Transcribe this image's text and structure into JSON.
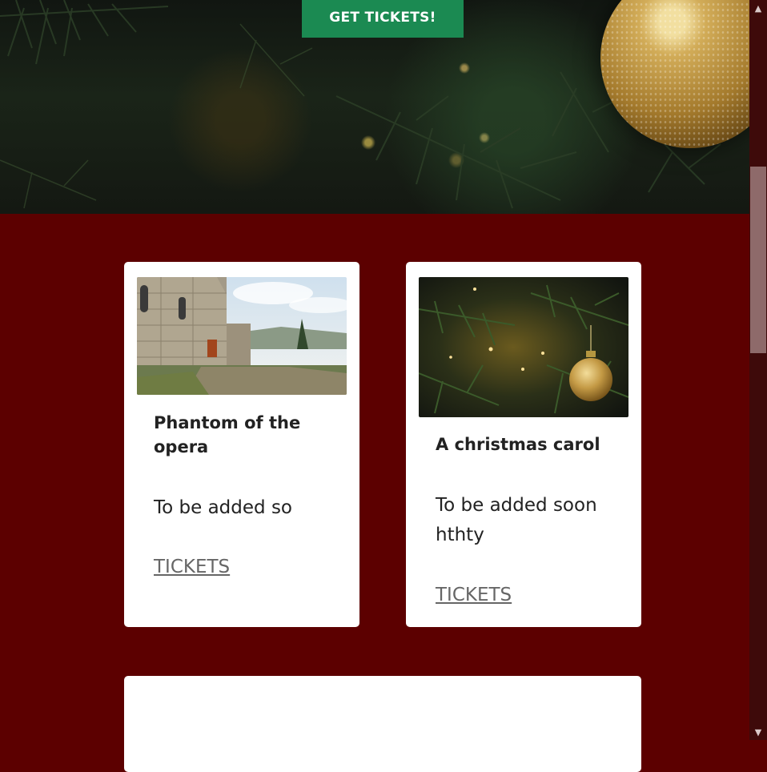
{
  "hero": {
    "cta_label": "GET TICKETS!",
    "cta_color": "#1b8a52"
  },
  "section": {
    "background_color": "#5c0000"
  },
  "cards": [
    {
      "image": "building-ruins-image",
      "title": "Phantom of the opera",
      "description": "To be added so",
      "link_label": "TICKETS"
    },
    {
      "image": "christmas-ornament-image",
      "title": "A christmas carol",
      "description": "To be added soon hthty",
      "link_label": "TICKETS"
    },
    {
      "image": "",
      "title": "",
      "description": "",
      "link_label": ""
    }
  ],
  "scrollbar": {
    "up_icon": "chevron-up-icon",
    "down_icon": "chevron-down-icon",
    "position_fraction": 0.28
  }
}
